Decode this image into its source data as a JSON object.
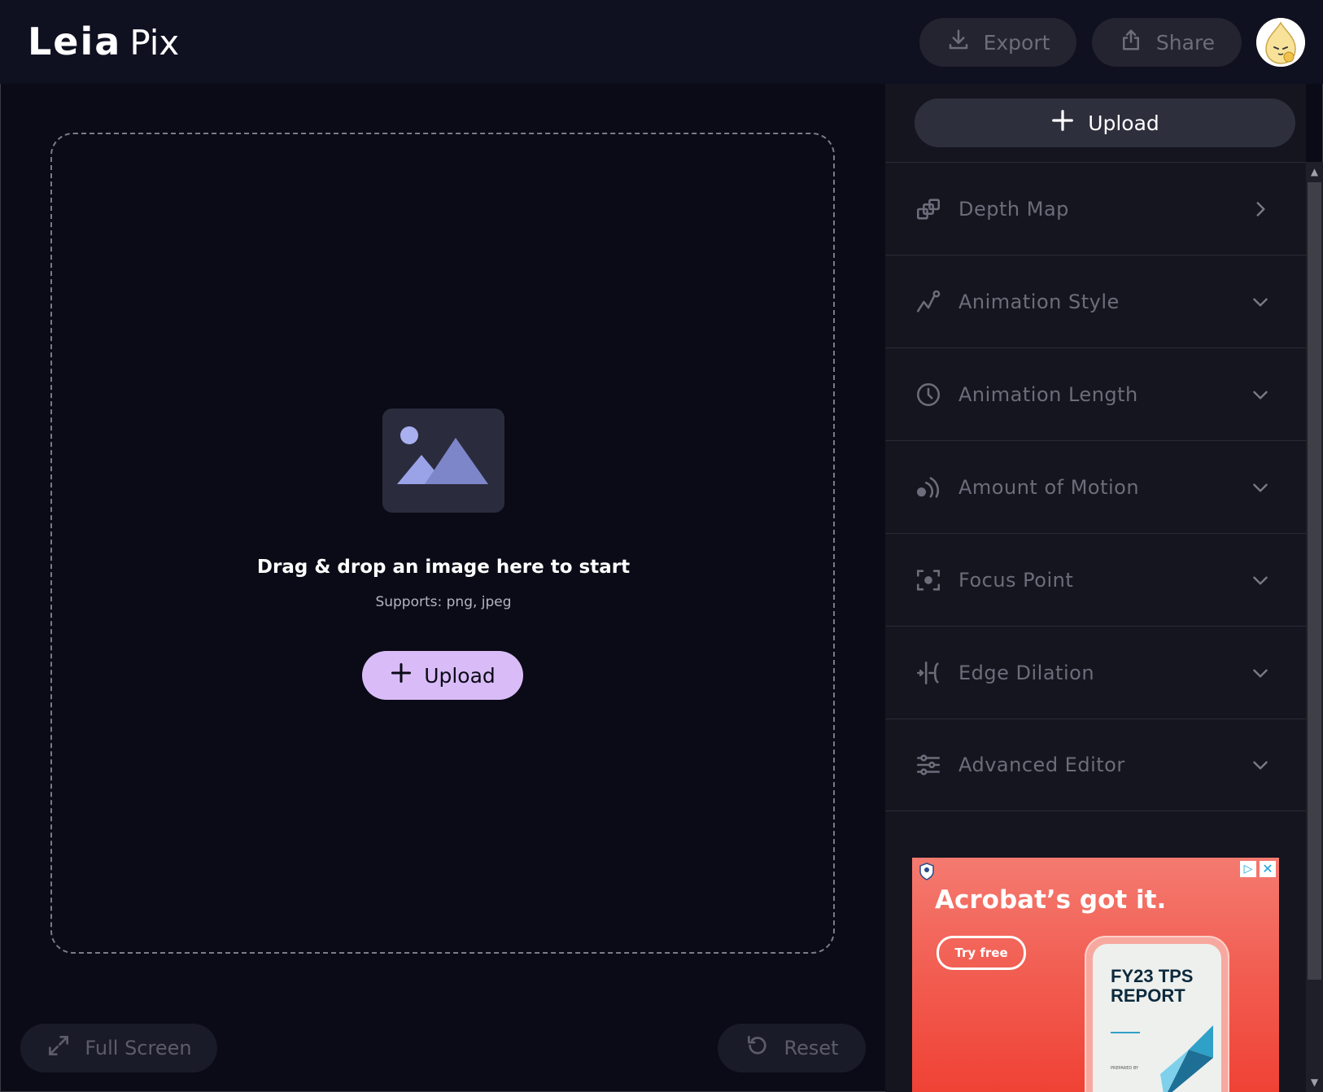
{
  "header": {
    "logo_primary": "Leia",
    "logo_secondary": "Pix",
    "export_label": "Export",
    "share_label": "Share"
  },
  "canvas": {
    "drop_title": "Drag & drop an image here to start",
    "drop_subtitle": "Supports: png, jpeg",
    "upload_label": "Upload",
    "fullscreen_label": "Full Screen",
    "reset_label": "Reset"
  },
  "sidebar": {
    "upload_label": "Upload",
    "items": [
      {
        "label": "Depth Map",
        "icon": "depth-map-icon",
        "chevron": "right"
      },
      {
        "label": "Animation Style",
        "icon": "animation-style-icon",
        "chevron": "down"
      },
      {
        "label": "Animation Length",
        "icon": "clock-icon",
        "chevron": "down"
      },
      {
        "label": "Amount of Motion",
        "icon": "motion-icon",
        "chevron": "down"
      },
      {
        "label": "Focus Point",
        "icon": "focus-point-icon",
        "chevron": "down"
      },
      {
        "label": "Edge Dilation",
        "icon": "edge-dilation-icon",
        "chevron": "down"
      },
      {
        "label": "Advanced Editor",
        "icon": "sliders-icon",
        "chevron": "down"
      }
    ]
  },
  "ad": {
    "headline": "Acrobat’s got it.",
    "cta": "Try free",
    "report_text": "FY23 TPS REPORT",
    "prepared_by": "PREPARED BY"
  },
  "colors": {
    "background": "#0b0b17",
    "header": "#0f1020",
    "sidebar": "#14151f",
    "accent_upload": "#d9bcf7",
    "muted_text": "#6c6d7a"
  }
}
